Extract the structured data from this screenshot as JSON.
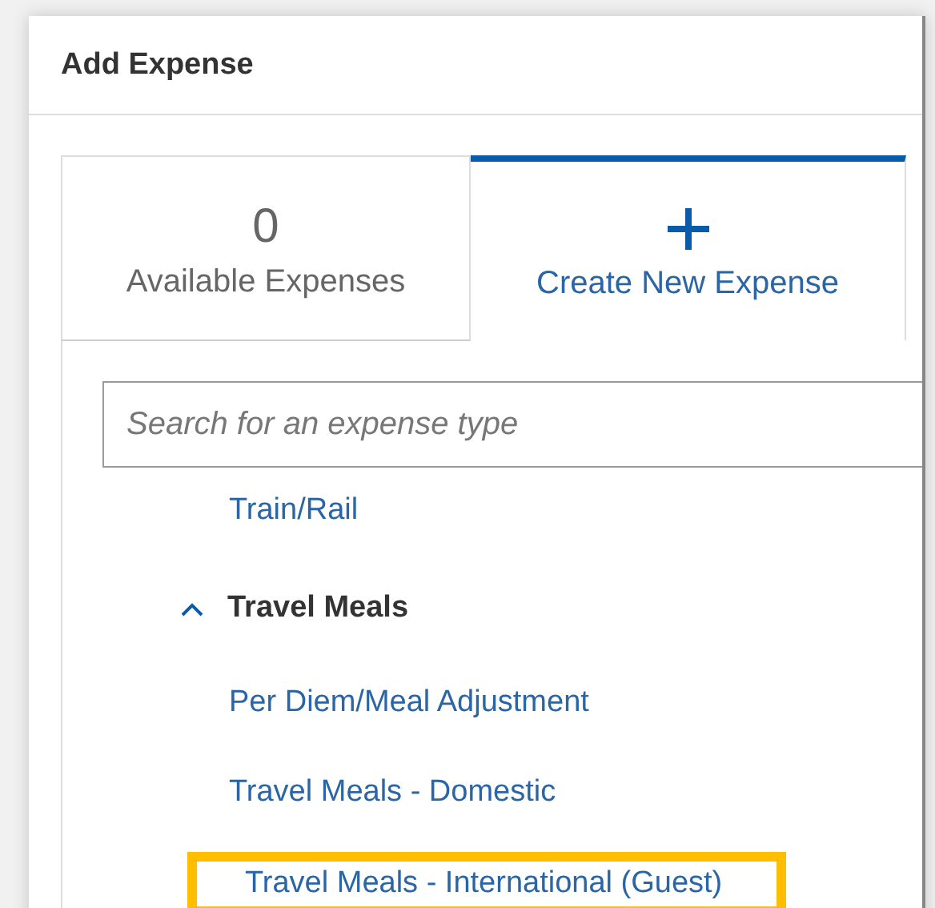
{
  "dialog": {
    "title": "Add Expense"
  },
  "tabs": [
    {
      "kind": "count",
      "count": "0",
      "label": "Available Expenses",
      "selected": false
    },
    {
      "kind": "create",
      "label": "Create New Expense",
      "selected": true
    }
  ],
  "search": {
    "placeholder": "Search for an expense type"
  },
  "expense_types": [
    {
      "kind": "item",
      "label": "Train/Rail",
      "highlighted": false
    },
    {
      "kind": "group",
      "label": "Travel Meals",
      "expanded": true,
      "children": [
        {
          "kind": "item",
          "label": "Per Diem/Meal Adjustment",
          "highlighted": false
        },
        {
          "kind": "item",
          "label": "Travel Meals - Domestic",
          "highlighted": false
        },
        {
          "kind": "item",
          "label": "Travel Meals - International (Guest)",
          "highlighted": true
        }
      ]
    }
  ]
}
